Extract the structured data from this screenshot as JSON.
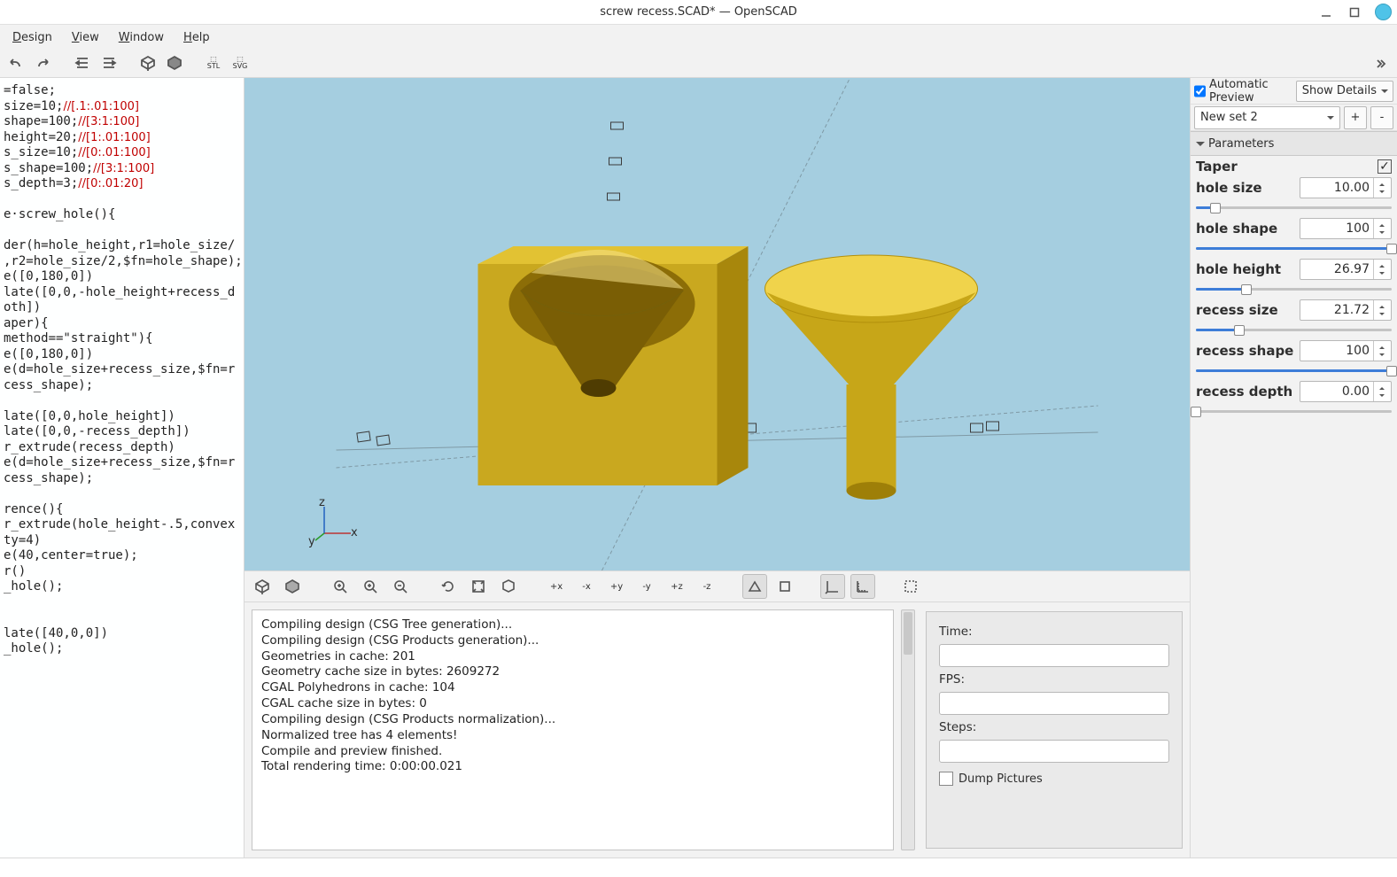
{
  "window": {
    "title": "screw recess.SCAD* — OpenSCAD"
  },
  "menu": {
    "design": "Design",
    "view": "View",
    "window": "Window",
    "help": "Help"
  },
  "toolbar_icons": [
    "undo",
    "redo",
    "unindent",
    "indent",
    "preview-cube",
    "render-cube",
    "export-stl",
    "export-svg",
    "more"
  ],
  "code": [
    "=false;",
    "size=10;",
    [
      "//[.1:.01:100]"
    ],
    "shape=100;",
    [
      "//[3:1:100]"
    ],
    "height=20;",
    [
      "//[1:.01:100]"
    ],
    "s_size=10;",
    [
      "//[0:.01:100]"
    ],
    "s_shape=100;",
    [
      "//[3:1:100]"
    ],
    "s_depth=3;",
    [
      "//[0:.01:20]"
    ],
    "",
    "e·screw_hole(){",
    "",
    "der(h=hole_height,r1=hole_size/",
    ",r2=hole_size/2,$fn=hole_shape);",
    "e([0,180,0])",
    "late([0,0,-hole_height+recess_d",
    "oth])",
    "aper){",
    "method==\"straight\"){",
    "e([0,180,0])",
    "e(d=hole_size+recess_size,$fn=r",
    "cess_shape);",
    "",
    "late([0,0,hole_height])",
    "late([0,0,-recess_depth])",
    "r_extrude(recess_depth)",
    "e(d=hole_size+recess_size,$fn=r",
    "cess_shape);",
    "",
    "rence(){",
    "r_extrude(hole_height-.5,convex",
    "ty=4)",
    "e(40,center=true);",
    "r()",
    "_hole();",
    "",
    "",
    "late([40,0,0])",
    "_hole();"
  ],
  "axes": {
    "x": "x",
    "y": "y",
    "z": "z"
  },
  "view_icons": [
    "preview",
    "render",
    "zoom-fit",
    "zoom-in",
    "zoom-out",
    "reset-view",
    "view-all",
    "surfaces",
    "axis-xp",
    "axis-xm",
    "axis-yp",
    "axis-ym",
    "axis-zp",
    "axis-zm",
    "perspective",
    "ortho",
    "show-axes",
    "show-scale",
    "crosshair"
  ],
  "console": [
    "Compiling design (CSG Tree generation)...",
    "Compiling design (CSG Products generation)...",
    "Geometries in cache: 201",
    "Geometry cache size in bytes: 2609272",
    "CGAL Polyhedrons in cache: 104",
    "CGAL cache size in bytes: 0",
    "Compiling design (CSG Products normalization)...",
    "Normalized tree has 4 elements!",
    "Compile and preview finished.",
    "Total rendering time: 0:00:00.021"
  ],
  "render_panel": {
    "time": "Time:",
    "fps": "FPS:",
    "steps": "Steps:",
    "dump": "Dump Pictures"
  },
  "customizer": {
    "auto_preview": "Automatic Preview",
    "show_details": "Show Details",
    "set_name": "New set 2",
    "plus": "+",
    "minus": "-",
    "group": "Parameters",
    "params": [
      {
        "label": "Taper",
        "type": "check",
        "checked": true
      },
      {
        "label": "hole size",
        "type": "spin",
        "value": "10.00",
        "slider_pct": 10
      },
      {
        "label": "hole shape",
        "type": "spin",
        "value": "100",
        "slider_pct": 100
      },
      {
        "label": "hole height",
        "type": "spin",
        "value": "26.97",
        "slider_pct": 26
      },
      {
        "label": "recess size",
        "type": "spin",
        "value": "21.72",
        "slider_pct": 22
      },
      {
        "label": "recess shape",
        "type": "spin",
        "value": "100",
        "slider_pct": 100
      },
      {
        "label": "recess depth",
        "type": "spin",
        "value": "0.00",
        "slider_pct": 0
      }
    ]
  },
  "statusbar": {
    "left": "",
    "right": ""
  }
}
